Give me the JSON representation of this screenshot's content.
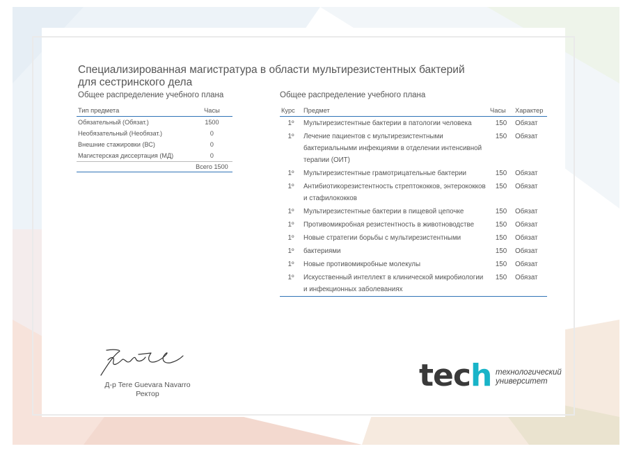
{
  "certificate": {
    "title": "Специализированная магистратура в области мультирезистентных бактерий для сестринского дела",
    "summary": {
      "heading": "Общее распределение учебного плана",
      "col_type": "Тип предмета",
      "col_hours": "Часы",
      "rows": [
        {
          "type": "Обязательный (Обязат.)",
          "hours": "1500"
        },
        {
          "type": "Необязательный (Необязат.)",
          "hours": "0"
        },
        {
          "type": "Внешние стажировки (ВС)",
          "hours": "0"
        },
        {
          "type": "Магистерская диссертация (МД)",
          "hours": "0"
        }
      ],
      "total": "Всего 1500"
    },
    "plan": {
      "heading": "Общее распределение учебного плана",
      "col_course": "Курс",
      "col_subject": "Предмет",
      "col_hours": "Часы",
      "col_type": "Характер",
      "rows": [
        {
          "course": "1º",
          "subject": "Мультирезистентные бактерии в патологии человека",
          "hours": "150",
          "type": "Обязат"
        },
        {
          "course": "1º",
          "subject": "Лечение пациентов с мультирезистентными бактериальными инфекциями в отделении интенсивной терапии (ОИТ)",
          "hours": "150",
          "type": "Обязат"
        },
        {
          "course": "1º",
          "subject": "Мультирезистентные грамотрицательные бактерии",
          "hours": "150",
          "type": "Обязат"
        },
        {
          "course": "1º",
          "subject": "Антибиотикорезистентность стрептококков, энтерококков и стафилококков",
          "hours": "150",
          "type": "Обязат"
        },
        {
          "course": "1º",
          "subject": "Мультирезистентные бактерии в пищевой цепочке",
          "hours": "150",
          "type": "Обязат"
        },
        {
          "course": "1º",
          "subject": "Противомикробная резистентность в животноводстве",
          "hours": "150",
          "type": "Обязат"
        },
        {
          "course": "1º",
          "subject": "Новые стратегии борьбы с мультирезистентными",
          "hours": "150",
          "type": "Обязат"
        },
        {
          "course": "1º",
          "subject": "бактериями",
          "hours": "150",
          "type": "Обязат"
        },
        {
          "course": "1º",
          "subject": "Новые противомикробные молекулы",
          "hours": "150",
          "type": "Обязат"
        },
        {
          "course": "1º",
          "subject": "Искусственный интеллект в клинической микробиологии и инфекционных заболеваниях",
          "hours": "150",
          "type": "Обязат"
        }
      ]
    },
    "signer_name": "Д-р Tere Guevara Navarro",
    "signer_role": "Ректор",
    "logo": {
      "word_a": "tec",
      "word_b": "h",
      "sub1": "технологический",
      "sub2": "университет"
    }
  }
}
